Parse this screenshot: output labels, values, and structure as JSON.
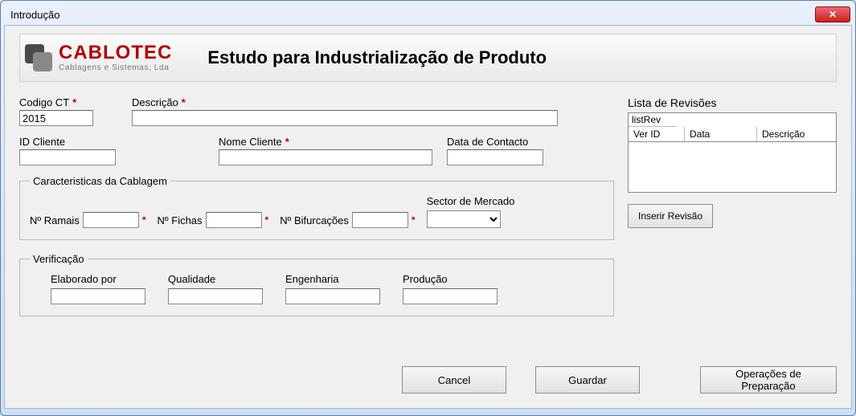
{
  "window": {
    "title": "Introdução"
  },
  "logo": {
    "name": "CABLOTEC",
    "sub": "Cablagens e Sistemas, Lda"
  },
  "header": {
    "title": "Estudo para Industrialização de Produto"
  },
  "fields": {
    "codigo_ct": {
      "label": "Codigo CT",
      "value": "2015"
    },
    "descricao": {
      "label": "Descrição",
      "value": ""
    },
    "id_cliente": {
      "label": "ID Cliente",
      "value": ""
    },
    "nome_cliente": {
      "label": "Nome Cliente",
      "value": ""
    },
    "data_contacto": {
      "label": "Data de Contacto",
      "value": ""
    }
  },
  "cablagem": {
    "legend": "Caracteristicas da Cablagem",
    "n_ramais": {
      "label": "Nº Ramais",
      "value": ""
    },
    "n_fichas": {
      "label": "Nº Fichas",
      "value": ""
    },
    "n_bifurcacoes": {
      "label": "Nº Bifurcações",
      "value": ""
    },
    "sector": {
      "label": "Sector de Mercado",
      "value": ""
    }
  },
  "verificacao": {
    "legend": "Verificação",
    "elaborado": {
      "label": "Elaborado por",
      "value": ""
    },
    "qualidade": {
      "label": "Qualidade",
      "value": ""
    },
    "engenharia": {
      "label": "Engenharia",
      "value": ""
    },
    "producao": {
      "label": "Produção",
      "value": ""
    }
  },
  "revisions": {
    "title": "Lista de Revisões",
    "list_label": "listRev",
    "cols": {
      "ver_id": "Ver ID",
      "data": "Data",
      "descricao": "Descrição"
    },
    "insert_btn": "Inserir Revisão"
  },
  "buttons": {
    "cancel": "Cancel",
    "guardar": "Guardar",
    "operacoes": "Operações de Preparação"
  },
  "asterisk": "*"
}
